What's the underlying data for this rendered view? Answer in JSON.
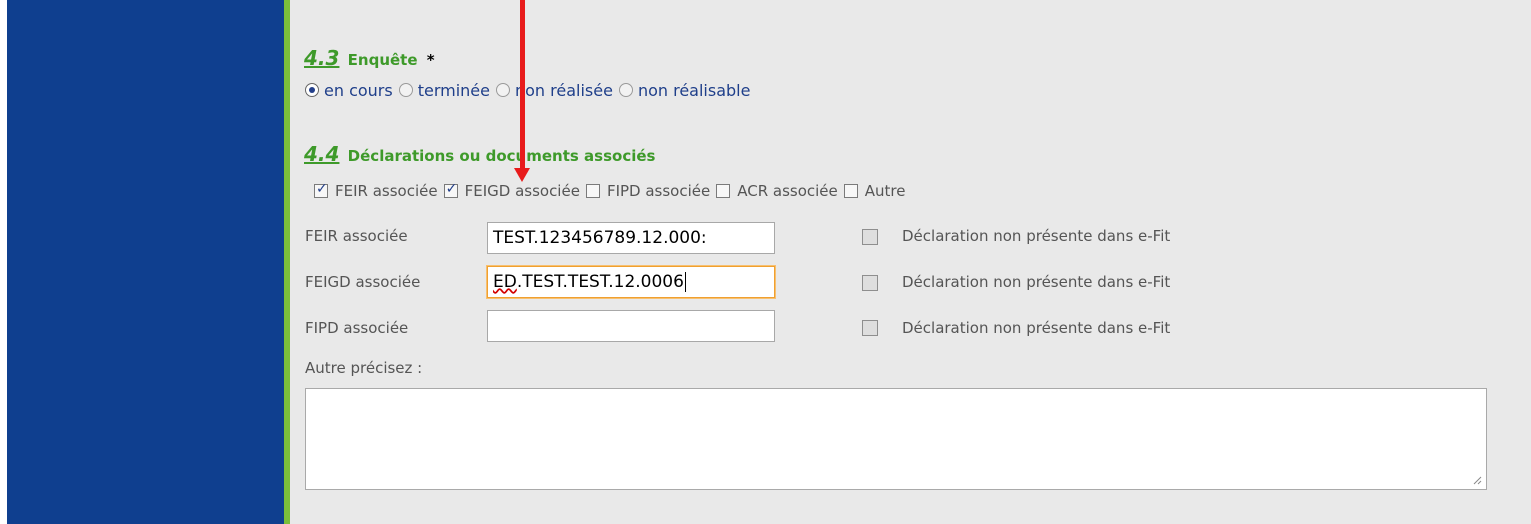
{
  "section_43": {
    "number": "4.3",
    "title": "Enquête",
    "required_mark": "*"
  },
  "radio_options": [
    {
      "label": "en cours",
      "checked": true
    },
    {
      "label": "terminée",
      "checked": false
    },
    {
      "label": "non réalisée",
      "checked": false
    },
    {
      "label": "non réalisable",
      "checked": false
    }
  ],
  "section_44": {
    "number": "4.4",
    "title": "Déclarations ou documents associés"
  },
  "checkbox_options": [
    {
      "label": "FEIR associée",
      "checked": true
    },
    {
      "label": "FEIGD associée",
      "checked": true
    },
    {
      "label": "FIPD associée",
      "checked": false
    },
    {
      "label": "ACR associée",
      "checked": false
    },
    {
      "label": "Autre",
      "checked": false
    }
  ],
  "fields": [
    {
      "label": "FEIR associée",
      "value": "TEST.123456789.12.000:",
      "not_present_label": "Déclaration non présente dans e-Fit"
    },
    {
      "label": "FEIGD associée",
      "value_prefix": "ED",
      "value_rest": ".TEST.TEST.12.0006",
      "not_present_label": "Déclaration non présente dans e-Fit"
    },
    {
      "label": "FIPD associée",
      "value": "",
      "not_present_label": "Déclaration non présente dans e-Fit"
    }
  ],
  "other_label": "Autre précisez :",
  "other_value": "",
  "colors": {
    "sidebar": "#0f3f8f",
    "accent_green": "#3e9a2a",
    "annotation_arrow": "#e81b1b"
  }
}
